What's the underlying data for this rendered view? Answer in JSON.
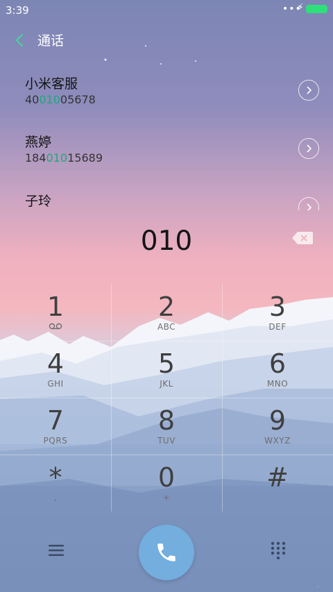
{
  "status_bar": {
    "time": "3:39",
    "dots": "•••"
  },
  "header": {
    "title": "通话"
  },
  "results": [
    {
      "name": "小米客服",
      "number_parts": [
        "40",
        "010",
        "05678"
      ]
    },
    {
      "name": "燕婷",
      "number_parts": [
        "184",
        "010",
        "15689"
      ]
    },
    {
      "name": "子玲",
      "number_parts": [
        "",
        "",
        ""
      ]
    }
  ],
  "dial": {
    "digits": "010"
  },
  "keypad": [
    {
      "digit": "1",
      "letters": ""
    },
    {
      "digit": "2",
      "letters": "ABC"
    },
    {
      "digit": "3",
      "letters": "DEF"
    },
    {
      "digit": "4",
      "letters": "GHI"
    },
    {
      "digit": "5",
      "letters": "JKL"
    },
    {
      "digit": "6",
      "letters": "MNO"
    },
    {
      "digit": "7",
      "letters": "PQRS"
    },
    {
      "digit": "8",
      "letters": "TUV"
    },
    {
      "digit": "9",
      "letters": "WXYZ"
    },
    {
      "digit": "*",
      "letters": ","
    },
    {
      "digit": "0",
      "letters": "+"
    },
    {
      "digit": "#",
      "letters": ""
    }
  ],
  "colors": {
    "accent": "#1aa978",
    "call_button": "#73aede",
    "back_arrow": "#3ed89a"
  },
  "icons": {
    "back": "chevron-left-icon",
    "voicemail": "voicemail-icon",
    "backspace": "backspace-icon",
    "menu": "menu-icon",
    "call": "phone-icon",
    "dialpad": "dialpad-icon"
  }
}
